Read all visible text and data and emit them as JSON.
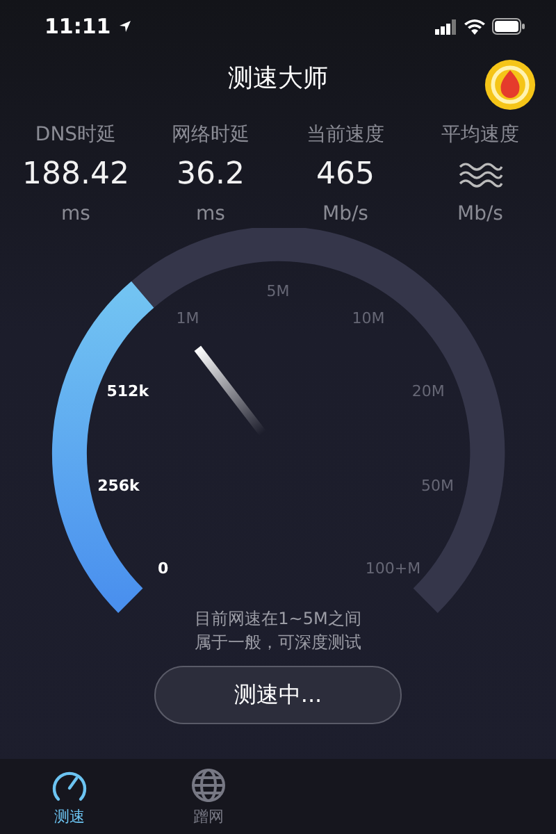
{
  "status_bar": {
    "time": "11:11"
  },
  "title": "测速大师",
  "stats": [
    {
      "label": "DNS时延",
      "value": "188.42",
      "unit": "ms"
    },
    {
      "label": "网络时延",
      "value": "36.2",
      "unit": "ms"
    },
    {
      "label": "当前速度",
      "value": "465",
      "unit": "Mb/s"
    },
    {
      "label": "平均速度",
      "unit": "Mb/s"
    }
  ],
  "gauge": {
    "ticks": [
      {
        "label": "0",
        "reached": true
      },
      {
        "label": "256k",
        "reached": true
      },
      {
        "label": "512k",
        "reached": true
      },
      {
        "label": "1M",
        "reached": false
      },
      {
        "label": "5M",
        "reached": false
      },
      {
        "label": "10M",
        "reached": false
      },
      {
        "label": "20M",
        "reached": false
      },
      {
        "label": "50M",
        "reached": false
      },
      {
        "label": "100+M",
        "reached": false
      }
    ]
  },
  "message": [
    "目前网速在1~5M之间",
    "属于一般，可深度测试"
  ],
  "button": "测速中...",
  "tabs": [
    {
      "label": "测速",
      "selected": true,
      "kind": "gauge"
    },
    {
      "label": "蹭网",
      "selected": false,
      "kind": "globe"
    }
  ]
}
